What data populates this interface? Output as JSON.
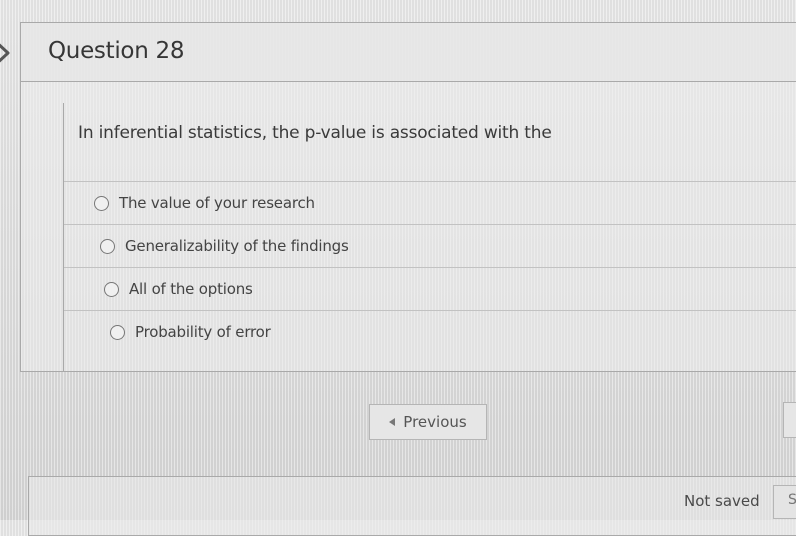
{
  "question": {
    "title": "Question 28",
    "prompt": "In inferential statistics, the p-value is associated with the",
    "options": [
      {
        "label": "The value of your research",
        "selected": false
      },
      {
        "label": "Generalizability of the findings",
        "selected": false
      },
      {
        "label": "All of the options",
        "selected": false
      },
      {
        "label": "Probability of error",
        "selected": false
      }
    ]
  },
  "navigation": {
    "previous_label": "Previous"
  },
  "footer": {
    "status": "Not saved",
    "save_label_partial": "S"
  }
}
